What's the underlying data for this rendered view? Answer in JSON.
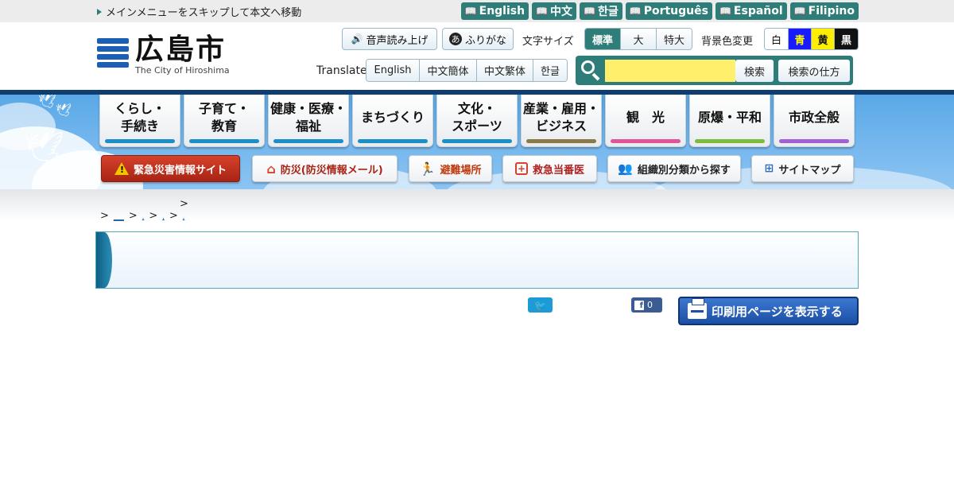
{
  "skip_link": "メインメニューをスキップして本文へ移動",
  "languages": [
    "English",
    "中文",
    "한글",
    "Português",
    "Español",
    "Filipino"
  ],
  "logo": {
    "title": "広島市",
    "subtitle": "The City of Hiroshima"
  },
  "header": {
    "read_aloud": "音声読み上げ",
    "furigana": "ふりがな",
    "furigana_icon": "あ",
    "font_size_label": "文字サイズ",
    "font_sizes": [
      "標準",
      "大",
      "特大"
    ],
    "bg_color_label": "背景色変更",
    "bg_colors": [
      {
        "label": "白",
        "bg": "#ffffff",
        "fg": "#111111"
      },
      {
        "label": "青",
        "bg": "#1a1aff",
        "fg": "#ffff00"
      },
      {
        "label": "黄",
        "bg": "#ffee00",
        "fg": "#111111"
      },
      {
        "label": "黒",
        "bg": "#111111",
        "fg": "#ffffff"
      }
    ],
    "translate_label": "Translate",
    "translate_options": [
      "English",
      "中文簡体",
      "中文繁体",
      "한글"
    ],
    "search_button": "検索",
    "search_help": "検索の仕方"
  },
  "gnav": [
    {
      "label": "くらし・\n手続き",
      "color": "#1a8fc8"
    },
    {
      "label": "子育て・\n教育",
      "color": "#1a8fc8"
    },
    {
      "label": "健康・医療・\n福祉",
      "color": "#1a8fc8"
    },
    {
      "label": "まちづくり",
      "color": "#1a8fc8"
    },
    {
      "label": "文化・\nスポーツ",
      "color": "#1a8fc8"
    },
    {
      "label": "産業・雇用・\nビジネス",
      "color": "#8a7a4a"
    },
    {
      "label": "観　光",
      "color": "#e0559a"
    },
    {
      "label": "原爆・平和",
      "color": "#7cbc3c"
    },
    {
      "label": "市政全般",
      "color": "#a25fd6"
    }
  ],
  "quick_links": {
    "emergency": "緊急災害情報サイト",
    "disaster_mail": "防災(防災情報メール)",
    "evacuation": "避難場所",
    "emergency_duty": "救急当番医",
    "org_search": "組織別分類から探す",
    "sitemap": "サイトマップ"
  },
  "breadcrumb": {
    "top_sep": ">",
    "items": [
      ">",
      "__",
      ">",
      ",",
      ">",
      ",",
      ">",
      ","
    ]
  },
  "facebook_count": "0",
  "print_button": "印刷用ページを表示する"
}
